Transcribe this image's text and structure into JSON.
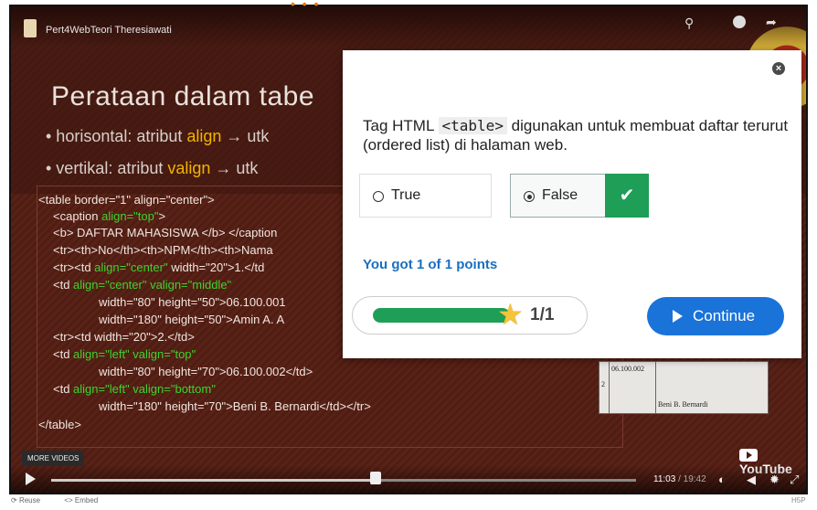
{
  "video": {
    "title": "Pert4WebTeori Theresiawati",
    "slide_heading": "Perataan dalam tabe",
    "bullet1_pre": "• horisontal: atribut ",
    "bullet1_hl": "align",
    "bullet1_post": " → utk",
    "bullet2_pre": "• vertikal: atribut ",
    "bullet2_hl": "valign",
    "bullet2_post": " → utk",
    "code": {
      "l1": "<table border=\"1\" align=\"center\">",
      "l2a": "<caption ",
      "l2g": "align=\"top\"",
      "l2b": ">",
      "l3": "<b> DAFTAR MAHASISWA </b> </caption",
      "l4": "<tr><th>No</th><th>NPM</th><th>Nama",
      "l5a": "<tr><td ",
      "l5g": "align=\"center\"",
      "l5b": " width=\"20\">1.</td",
      "l6a": "<td ",
      "l6g": "align=\"center\" valign=\"middle\"",
      "l7": "width=\"80\" height=\"50\">06.100.001",
      "l8": "width=\"180\" height=\"50\">Amin A. A",
      "l9": "<tr><td width=\"20\">2.</td>",
      "l10a": "<td ",
      "l10g": "align=\"left\" valign=\"top\"",
      "l11": "width=\"80\" height=\"70\">06.100.002</td>",
      "l12a": "<td ",
      "l12g": "align=\"left\" valign=\"bottom\"",
      "l13": "width=\"180\" height=\"70\">Beni B. Bernardi</td></tr>",
      "l14": "</table>"
    },
    "preview": {
      "num": "2",
      "npm": "06.100.002",
      "name": "Beni B. Bernardi"
    },
    "more_videos": "MORE VIDEOS",
    "youtube": "YouTube",
    "time_current": "11:03",
    "time_total": " / 19:42",
    "progress": 0.55
  },
  "bottom": {
    "reuse": "Reuse",
    "embed": "<> Embed",
    "h5p": "H5P"
  },
  "quiz": {
    "question_pre": "Tag HTML ",
    "question_code": "<table>",
    "question_post": " digunakan untuk membuat daftar terurut (ordered list) di halaman web.",
    "option_true": "True",
    "option_false": "False",
    "selected": "False",
    "score_text": "You got 1 of 1 points",
    "score_value": "1/1",
    "score_fraction": 1.0,
    "continue_label": "Continue"
  },
  "icons": [
    "search-icon",
    "clock-icon",
    "share-icon",
    "close-icon",
    "check-icon",
    "star-icon",
    "play-icon",
    "settings-icon",
    "volume-icon",
    "fullscreen-icon"
  ]
}
